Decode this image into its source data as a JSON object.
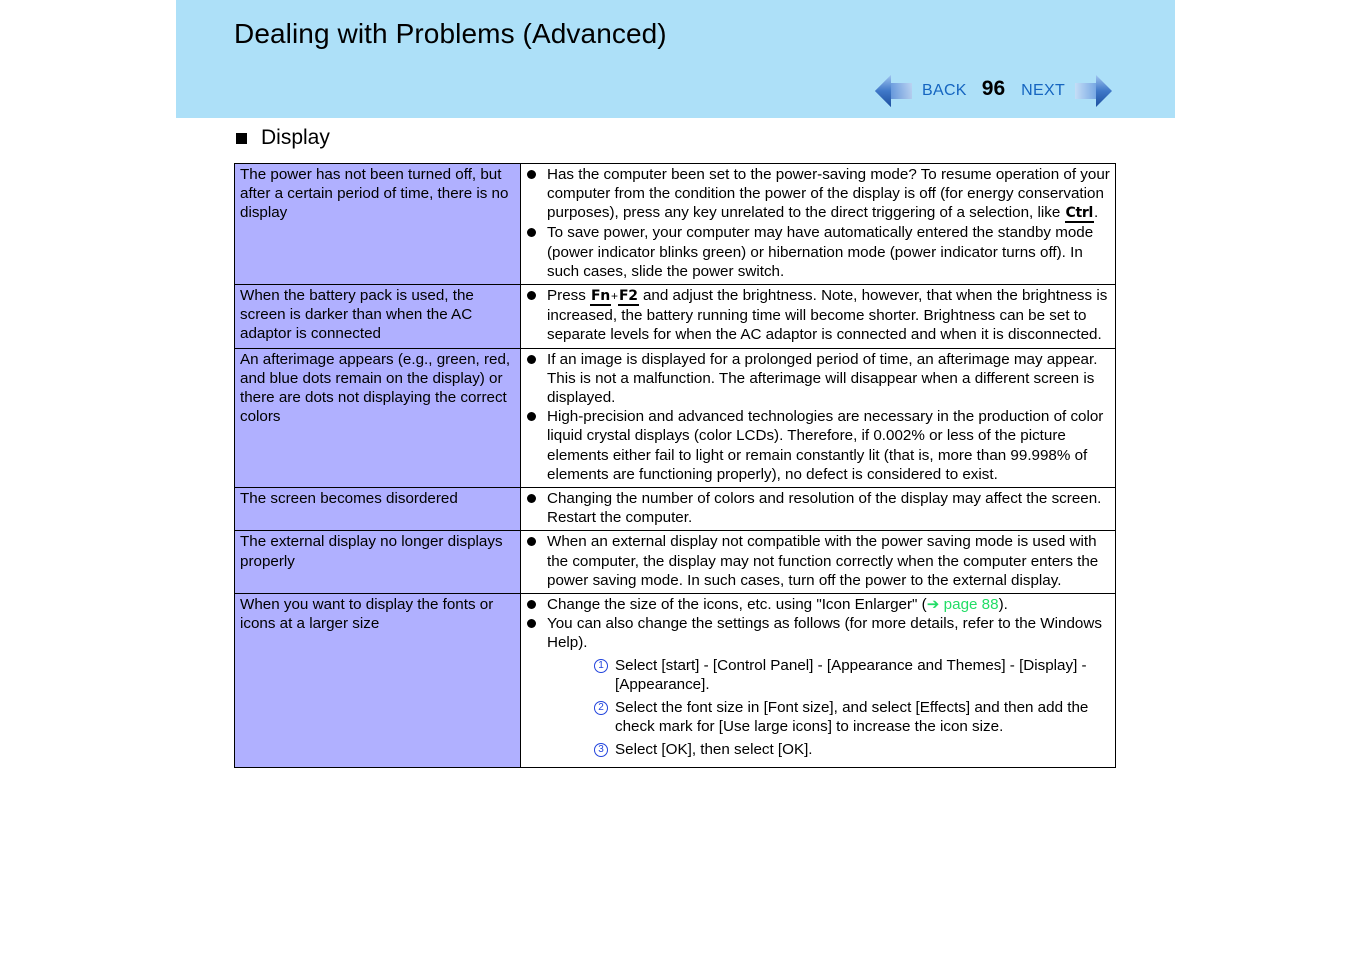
{
  "header": {
    "title": "Dealing with Problems (Advanced)",
    "back_label": "BACK",
    "page_number": "96",
    "next_label": "NEXT",
    "back_icon": "back-arrow-icon",
    "next_icon": "next-arrow-icon"
  },
  "section": {
    "heading": "Display",
    "bullet_icon": "square-bullet-icon"
  },
  "colors": {
    "header_bg": "#ade0f8",
    "problem_cell_bg": "#b0b0ff",
    "nav_link": "#1565c0",
    "page_link": "#22dd66",
    "step_number": "#2244dd"
  },
  "rows": [
    {
      "problem": "The power has not been turned off, but after a certain period of time, there is no display",
      "solutions": [
        {
          "before": "Has the computer been set to the power-saving mode? To resume operation of your computer from the condition the power of the display is off (for energy conservation purposes), press any key unrelated to the direct triggering of a selection, like ",
          "key": "Ctrl",
          "after": "."
        },
        {
          "text": "To save power, your computer may have automatically entered the standby mode (power indicator blinks green) or hibernation mode (power indicator turns off).  In such cases, slide the power switch."
        }
      ]
    },
    {
      "problem": "When the battery pack is used, the screen is darker than when the AC adaptor is connected",
      "solutions": [
        {
          "before": "Press ",
          "key1": "Fn",
          "plus": "+",
          "key2": "F2",
          "after": " and adjust the brightness.  Note, however, that when the brightness is increased, the battery running time will become shorter.  Brightness can be set to separate levels for when the AC adaptor is connected and when it is disconnected."
        }
      ]
    },
    {
      "problem": "An afterimage appears (e.g., green, red, and blue dots remain on the display) or there are dots not displaying the correct colors",
      "solutions": [
        {
          "text": "If an image is displayed for a prolonged period of time, an afterimage may appear.   This is not a malfunction.  The afterimage will disappear when a different screen is displayed."
        },
        {
          "text": "High-precision and advanced technologies are necessary in the production of color liquid crystal displays (color LCDs). Therefore, if 0.002% or less of the picture elements either fail to light or remain constantly lit (that is, more than 99.998% of elements are functioning properly), no defect is considered to exist."
        }
      ]
    },
    {
      "problem": "The screen becomes disordered",
      "solutions": [
        {
          "text": "Changing the number of colors and resolution of the display may affect the screen.  Restart the computer."
        }
      ]
    },
    {
      "problem": "The external display no longer displays properly",
      "solutions": [
        {
          "text": "When an external display not compatible with the power saving mode is used with the computer, the display may not function correctly when the computer enters the power saving mode.  In such cases, turn off the power to the external display."
        }
      ]
    },
    {
      "problem": "When you want to display the fonts or icons at a larger size",
      "solutions": [
        {
          "before": "Change the size of the icons, etc. using \"Icon Enlarger\" (",
          "link_arrow": "➔",
          "link_text": " page 88",
          "after": ")."
        },
        {
          "text": "You can also change the settings as follows (for more details, refer to the Windows Help)."
        }
      ],
      "steps": [
        {
          "num": "1",
          "text": "Select [start] - [Control Panel] - [Appearance and Themes] - [Display] - [Appearance]."
        },
        {
          "num": "2",
          "text": "Select the font size in [Font size], and select [Effects] and then add the check mark for [Use large icons] to increase the icon size."
        },
        {
          "num": "3",
          "text": "Select [OK], then select [OK]."
        }
      ]
    }
  ]
}
